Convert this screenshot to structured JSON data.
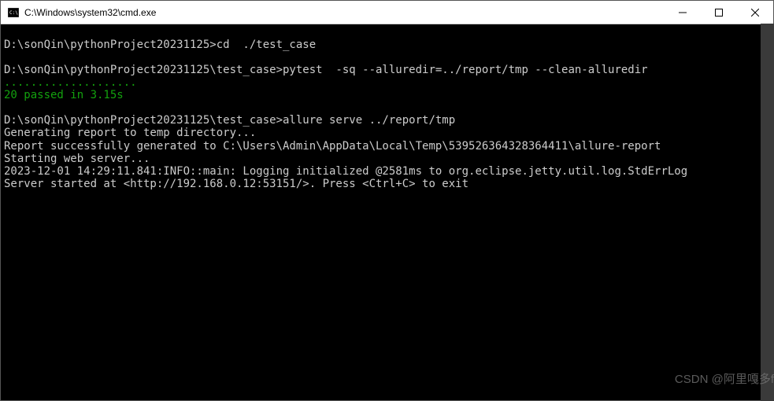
{
  "window": {
    "title": "C:\\Windows\\system32\\cmd.exe"
  },
  "console": {
    "lines": [
      {
        "text": "",
        "cls": "white"
      },
      {
        "text": "D:\\sonQin\\pythonProject20231125>cd  ./test_case",
        "cls": "white"
      },
      {
        "text": "",
        "cls": "white"
      },
      {
        "text": "D:\\sonQin\\pythonProject20231125\\test_case>pytest  -sq --alluredir=../report/tmp --clean-alluredir",
        "cls": "white"
      },
      {
        "text": "....................",
        "cls": "green"
      },
      {
        "text": "20 passed in 3.15s",
        "cls": "green"
      },
      {
        "text": "",
        "cls": "white"
      },
      {
        "text": "D:\\sonQin\\pythonProject20231125\\test_case>allure serve ../report/tmp",
        "cls": "white"
      },
      {
        "text": "Generating report to temp directory...",
        "cls": "white"
      },
      {
        "text": "Report successfully generated to C:\\Users\\Admin\\AppData\\Local\\Temp\\539526364328364411\\allure-report",
        "cls": "white"
      },
      {
        "text": "Starting web server...",
        "cls": "white"
      },
      {
        "text": "2023-12-01 14:29:11.841:INFO::main: Logging initialized @2581ms to org.eclipse.jetty.util.log.StdErrLog",
        "cls": "white"
      },
      {
        "text": "Server started at <http://192.168.0.12:53151/>. Press <Ctrl+C> to exit",
        "cls": "white"
      }
    ]
  },
  "watermark": "CSDN @阿里嘎多f"
}
